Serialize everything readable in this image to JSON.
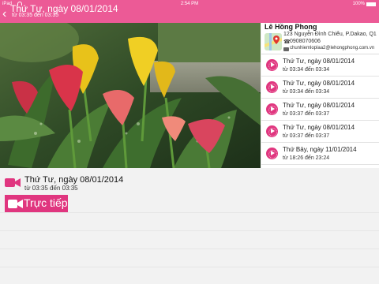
{
  "status_bar": {
    "carrier": "iPad",
    "time": "2:54 PM",
    "battery": "100%"
  },
  "nav": {
    "back_icon": "chevron-left",
    "title": "Thứ Tư, ngày 08/01/2014",
    "subtitle": "từ 03:35 đến 03:35"
  },
  "contact": {
    "name": "Lê Hồng Phong",
    "address": "123 Nguyễn Đình Chiểu, P.Dakao, Q1",
    "phone": "0908070606",
    "email": "chunhiemloplaa2@lehongphong.com.vn"
  },
  "sessions": [
    {
      "date": "Thứ Tư, ngày 08/01/2014",
      "time": "từ 03:34 đến 03:34"
    },
    {
      "date": "Thứ Tư, ngày 08/01/2014",
      "time": "từ 03:34 đến 03:34"
    },
    {
      "date": "Thứ Tư, ngày 08/01/2014",
      "time": "từ 03:37 đến 03:37"
    },
    {
      "date": "Thứ Tư, ngày 08/01/2014",
      "time": "từ 03:37 đến 03:37"
    },
    {
      "date": "Thứ Bảy, ngày 11/01/2014",
      "time": "từ 18:26 đến 23:24"
    }
  ],
  "current": {
    "date": "Thứ Tư, ngày 08/01/2014",
    "time": "từ 03:35 đến 03:35"
  },
  "live_button": {
    "label": "Trực tiếp",
    "icon": "video-camera"
  },
  "colors": {
    "accent": "#e0367f",
    "bar": "#ec5a96"
  }
}
